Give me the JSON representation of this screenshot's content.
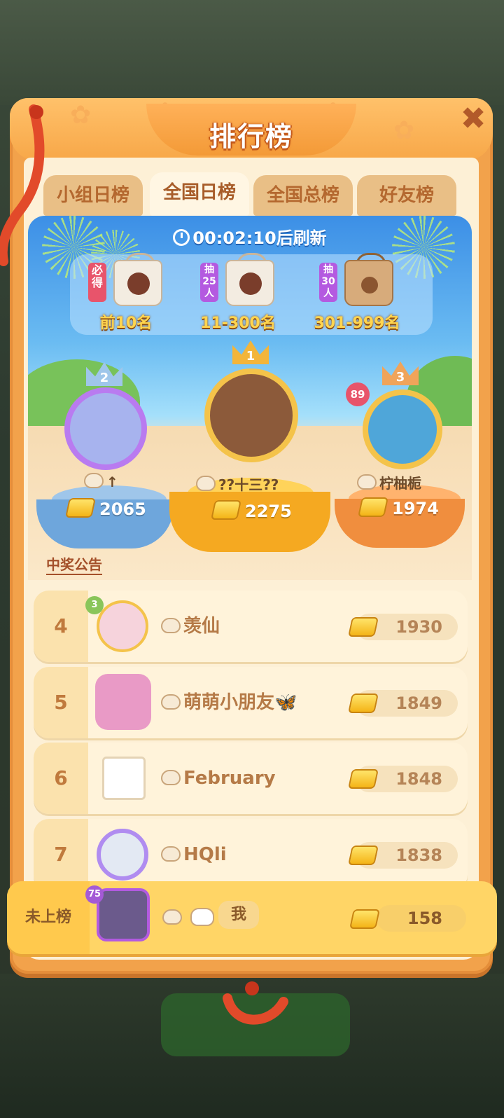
{
  "panel": {
    "title": "排行榜",
    "close_icon": "close-icon"
  },
  "tabs": [
    {
      "label": "小组日榜",
      "active": false
    },
    {
      "label": "全国日榜",
      "active": true
    },
    {
      "label": "全国总榜",
      "active": false
    },
    {
      "label": "好友榜",
      "active": false
    }
  ],
  "refresh": {
    "countdown": "00:02:10",
    "suffix": "后刷新"
  },
  "prizes": [
    {
      "tag": "必得",
      "range": "前10名",
      "tag_color": "#e8546b"
    },
    {
      "tag": "抽25人",
      "range": "11-300名",
      "tag_color": "#b45ae0"
    },
    {
      "tag": "抽30人",
      "range": "301-999名",
      "tag_color": "#b45ae0"
    }
  ],
  "podium": {
    "first": {
      "rank": "1",
      "name": "??十三??",
      "score": "2275"
    },
    "second": {
      "rank": "2",
      "name": "↑",
      "score": "2065"
    },
    "third": {
      "rank": "3",
      "name": "柠柚栀",
      "score": "1974",
      "level": "89"
    }
  },
  "notice_link": "中奖公告",
  "rows": [
    {
      "rank": "4",
      "name": "羡仙",
      "score": "1930",
      "level": "3"
    },
    {
      "rank": "5",
      "name": "萌萌小朋友🦋",
      "score": "1849"
    },
    {
      "rank": "6",
      "name": "February",
      "score": "1848"
    },
    {
      "rank": "7",
      "name": "HQli",
      "score": "1838"
    }
  ],
  "me": {
    "rank_label": "未上榜",
    "name": "我",
    "score": "158",
    "level": "75"
  },
  "colors": {
    "accent": "#f2a24b",
    "title_stroke": "#c45a1c",
    "gold": "#f4b417"
  }
}
